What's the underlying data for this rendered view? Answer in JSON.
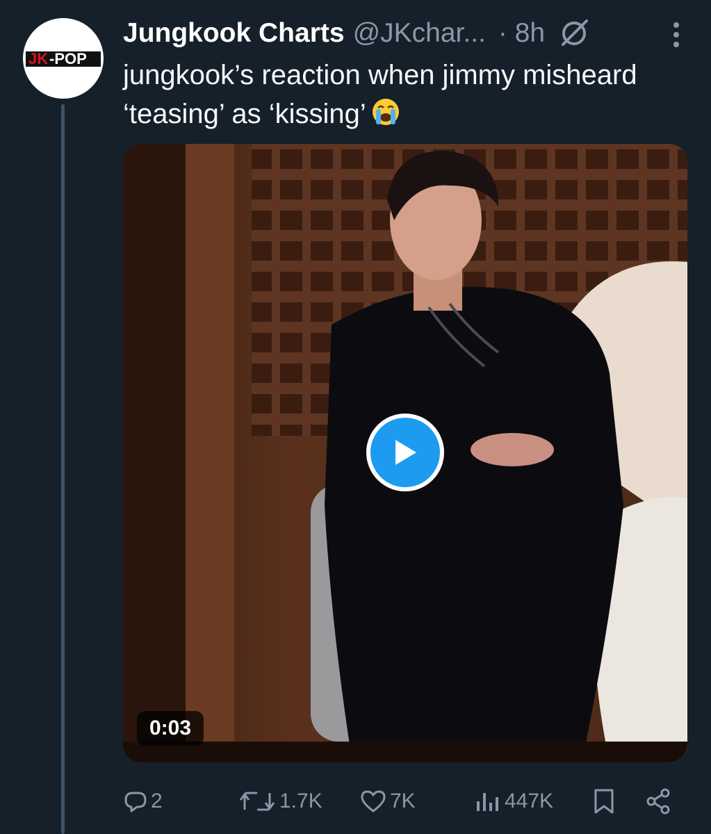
{
  "author": {
    "display_name": "Jungkook Charts",
    "handle": "@JKchar...",
    "time": "· 8h",
    "avatar_logo": "JK-POP"
  },
  "tweet": {
    "text": "jungkook’s reaction when jimmy misheard ‘teasing’ as ‘kissing’"
  },
  "media": {
    "duration": "0:03"
  },
  "actions": {
    "replies": "2",
    "reposts": "1.7K",
    "likes": "7K",
    "views": "447K"
  },
  "colors": {
    "background": "#15202b",
    "secondary_text": "#8b98a5",
    "accent": "#1d9bf0"
  },
  "icons": [
    "grok-icon",
    "more-icon",
    "crying-emoji-icon",
    "play-icon",
    "reply-icon",
    "repost-icon",
    "like-icon",
    "views-icon",
    "bookmark-icon",
    "share-icon"
  ]
}
